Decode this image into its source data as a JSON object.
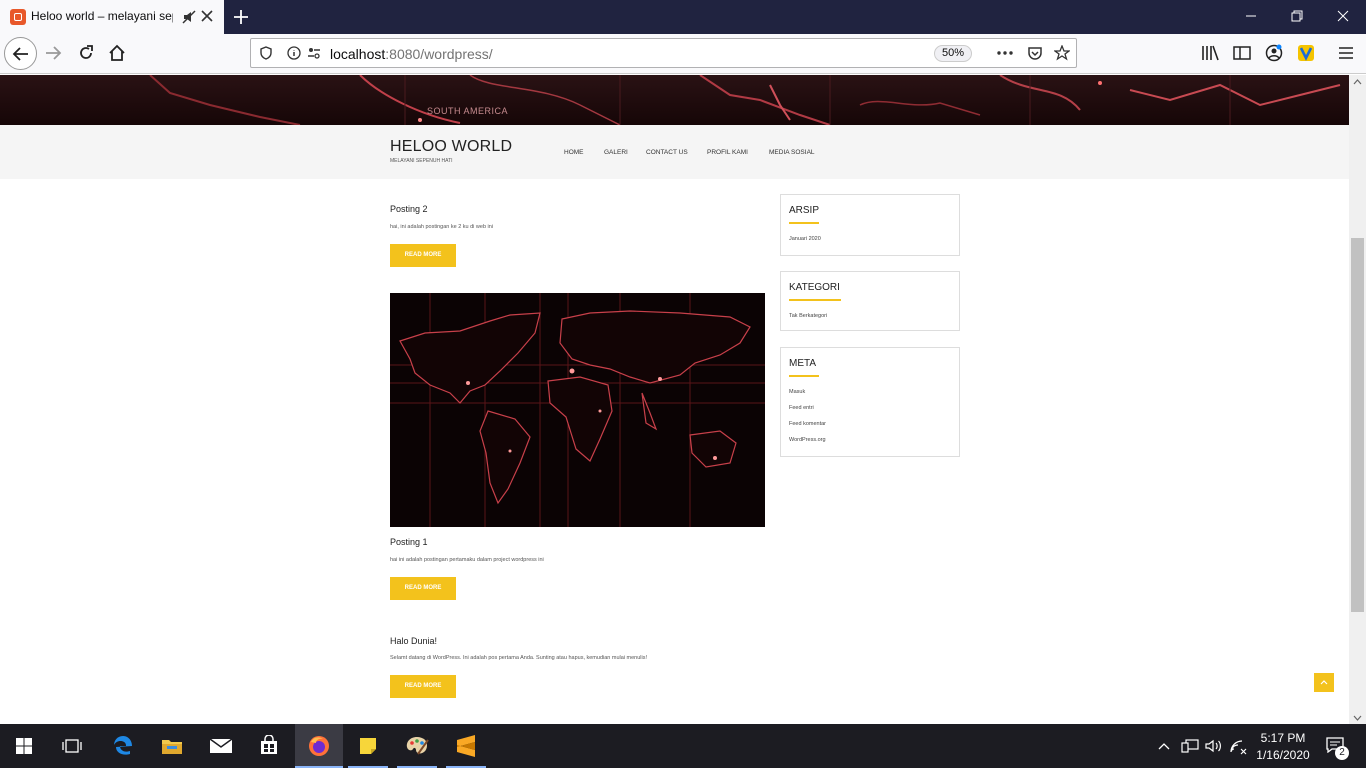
{
  "browser": {
    "tab_title": "Heloo world – melayani sepenuh hati",
    "url_host": "localhost",
    "url_rest": ":8080/wordpress/",
    "zoom": "50%"
  },
  "site": {
    "hero_label": "SOUTH AMERICA",
    "title": "HELOO WORLD",
    "description": "MELAYANI SEPENUH HATI",
    "menu": [
      "HOME",
      "GALERI",
      "CONTACT US",
      "PROFIL KAMI",
      "MEDIA SOSIAL"
    ]
  },
  "posts": [
    {
      "title": "Posting 2",
      "excerpt": "hai, ini adalah postingan ke 2 ku di web ini",
      "button": "READ MORE"
    },
    {
      "title": "Posting 1",
      "excerpt": "hai ini adalah postingan pertamaku dalam project wordpress ini",
      "button": "READ MORE"
    },
    {
      "title": "Halo Dunia!",
      "excerpt": "Selamt datang di WordPress. Ini adalah pos pertama Anda. Sunting atau hapus, kemudian mulai menulis!",
      "button": "READ MORE"
    }
  ],
  "sidebar": {
    "arsip": {
      "title": "ARSIP",
      "links": [
        "Januari 2020"
      ]
    },
    "kategori": {
      "title": "KATEGORI",
      "links": [
        "Tak Berkategori"
      ]
    },
    "meta": {
      "title": "META",
      "links": [
        "Masuk",
        "Feed entri",
        "Feed komentar",
        "WordPress.org"
      ]
    }
  },
  "taskbar": {
    "time": "5:17 PM",
    "date": "1/16/2020",
    "notifications": "2"
  },
  "colors": {
    "accent": "#f3c21c",
    "tabbar": "#202340",
    "taskbar": "#1c1c22"
  }
}
